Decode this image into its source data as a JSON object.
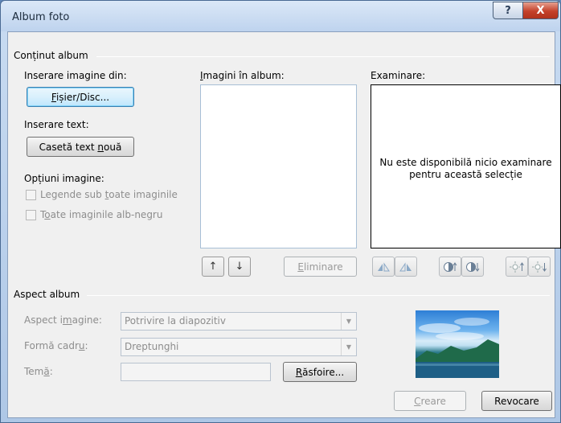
{
  "window": {
    "title": "Album foto",
    "help_label": "?",
    "close_label": "X"
  },
  "album_content": {
    "group_label": "Conținut album",
    "insert_image_from": "Inserare imagine din:",
    "file_disk_button": {
      "pre": "",
      "key": "F",
      "post": "ișier/Disc..."
    },
    "insert_text": "Inserare text:",
    "new_textbox_button": {
      "pre": "Casetă text ",
      "key": "n",
      "post": "ouă"
    },
    "image_options": "Opțiuni imagine:",
    "captions_checkbox": {
      "pre": "Legende sub ",
      "key": "t",
      "post": "oate imaginile",
      "checked": false,
      "enabled": false
    },
    "bw_checkbox": {
      "pre": "T",
      "key": "o",
      "post": "ate imaginile alb-negru",
      "checked": false,
      "enabled": false
    },
    "pictures_in_album": {
      "pre": "",
      "key": "I",
      "post": "magini în album:"
    },
    "preview_label": "Examinare:",
    "preview_message": "Nu este disponibilă nicio examinare pentru această selecție",
    "move_up_icon": "↑",
    "move_down_icon": "↓",
    "remove_button": {
      "pre": "",
      "key": "E",
      "post": "liminare",
      "enabled": false
    },
    "preview_tools": [
      "rotate-left-icon",
      "rotate-right-icon",
      "contrast-up-icon",
      "contrast-down-icon",
      "brightness-up-icon",
      "brightness-down-icon"
    ]
  },
  "album_layout": {
    "group_label": "Aspect album",
    "picture_layout_label": {
      "pre": "Aspect i",
      "key": "m",
      "post": "agine:"
    },
    "picture_layout_value": "Potrivire la diapozitiv",
    "frame_shape_label": {
      "pre": "Formă cadr",
      "key": "u",
      "post": ":"
    },
    "frame_shape_value": "Dreptunghi",
    "theme_label": {
      "pre": "Tem",
      "key": "ă",
      "post": ":"
    },
    "theme_value": "",
    "browse_button": {
      "pre": "",
      "key": "R",
      "post": "ăsfoire..."
    }
  },
  "footer": {
    "create_button": {
      "pre": "",
      "key": "C",
      "post": "reare",
      "enabled": false
    },
    "cancel_button": "Revocare"
  }
}
